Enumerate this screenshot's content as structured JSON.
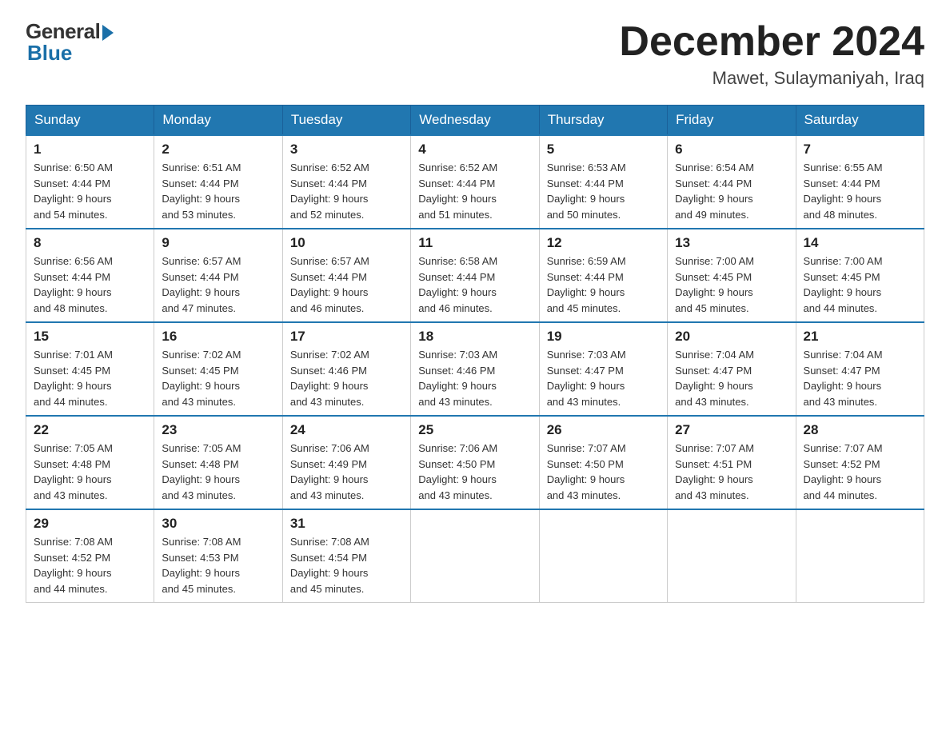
{
  "header": {
    "logo_general": "General",
    "logo_blue": "Blue",
    "month_title": "December 2024",
    "location": "Mawet, Sulaymaniyah, Iraq"
  },
  "days_of_week": [
    "Sunday",
    "Monday",
    "Tuesday",
    "Wednesday",
    "Thursday",
    "Friday",
    "Saturday"
  ],
  "weeks": [
    [
      {
        "day": "1",
        "sunrise": "6:50 AM",
        "sunset": "4:44 PM",
        "daylight": "9 hours and 54 minutes."
      },
      {
        "day": "2",
        "sunrise": "6:51 AM",
        "sunset": "4:44 PM",
        "daylight": "9 hours and 53 minutes."
      },
      {
        "day": "3",
        "sunrise": "6:52 AM",
        "sunset": "4:44 PM",
        "daylight": "9 hours and 52 minutes."
      },
      {
        "day": "4",
        "sunrise": "6:52 AM",
        "sunset": "4:44 PM",
        "daylight": "9 hours and 51 minutes."
      },
      {
        "day": "5",
        "sunrise": "6:53 AM",
        "sunset": "4:44 PM",
        "daylight": "9 hours and 50 minutes."
      },
      {
        "day": "6",
        "sunrise": "6:54 AM",
        "sunset": "4:44 PM",
        "daylight": "9 hours and 49 minutes."
      },
      {
        "day": "7",
        "sunrise": "6:55 AM",
        "sunset": "4:44 PM",
        "daylight": "9 hours and 48 minutes."
      }
    ],
    [
      {
        "day": "8",
        "sunrise": "6:56 AM",
        "sunset": "4:44 PM",
        "daylight": "9 hours and 48 minutes."
      },
      {
        "day": "9",
        "sunrise": "6:57 AM",
        "sunset": "4:44 PM",
        "daylight": "9 hours and 47 minutes."
      },
      {
        "day": "10",
        "sunrise": "6:57 AM",
        "sunset": "4:44 PM",
        "daylight": "9 hours and 46 minutes."
      },
      {
        "day": "11",
        "sunrise": "6:58 AM",
        "sunset": "4:44 PM",
        "daylight": "9 hours and 46 minutes."
      },
      {
        "day": "12",
        "sunrise": "6:59 AM",
        "sunset": "4:44 PM",
        "daylight": "9 hours and 45 minutes."
      },
      {
        "day": "13",
        "sunrise": "7:00 AM",
        "sunset": "4:45 PM",
        "daylight": "9 hours and 45 minutes."
      },
      {
        "day": "14",
        "sunrise": "7:00 AM",
        "sunset": "4:45 PM",
        "daylight": "9 hours and 44 minutes."
      }
    ],
    [
      {
        "day": "15",
        "sunrise": "7:01 AM",
        "sunset": "4:45 PM",
        "daylight": "9 hours and 44 minutes."
      },
      {
        "day": "16",
        "sunrise": "7:02 AM",
        "sunset": "4:45 PM",
        "daylight": "9 hours and 43 minutes."
      },
      {
        "day": "17",
        "sunrise": "7:02 AM",
        "sunset": "4:46 PM",
        "daylight": "9 hours and 43 minutes."
      },
      {
        "day": "18",
        "sunrise": "7:03 AM",
        "sunset": "4:46 PM",
        "daylight": "9 hours and 43 minutes."
      },
      {
        "day": "19",
        "sunrise": "7:03 AM",
        "sunset": "4:47 PM",
        "daylight": "9 hours and 43 minutes."
      },
      {
        "day": "20",
        "sunrise": "7:04 AM",
        "sunset": "4:47 PM",
        "daylight": "9 hours and 43 minutes."
      },
      {
        "day": "21",
        "sunrise": "7:04 AM",
        "sunset": "4:47 PM",
        "daylight": "9 hours and 43 minutes."
      }
    ],
    [
      {
        "day": "22",
        "sunrise": "7:05 AM",
        "sunset": "4:48 PM",
        "daylight": "9 hours and 43 minutes."
      },
      {
        "day": "23",
        "sunrise": "7:05 AM",
        "sunset": "4:48 PM",
        "daylight": "9 hours and 43 minutes."
      },
      {
        "day": "24",
        "sunrise": "7:06 AM",
        "sunset": "4:49 PM",
        "daylight": "9 hours and 43 minutes."
      },
      {
        "day": "25",
        "sunrise": "7:06 AM",
        "sunset": "4:50 PM",
        "daylight": "9 hours and 43 minutes."
      },
      {
        "day": "26",
        "sunrise": "7:07 AM",
        "sunset": "4:50 PM",
        "daylight": "9 hours and 43 minutes."
      },
      {
        "day": "27",
        "sunrise": "7:07 AM",
        "sunset": "4:51 PM",
        "daylight": "9 hours and 43 minutes."
      },
      {
        "day": "28",
        "sunrise": "7:07 AM",
        "sunset": "4:52 PM",
        "daylight": "9 hours and 44 minutes."
      }
    ],
    [
      {
        "day": "29",
        "sunrise": "7:08 AM",
        "sunset": "4:52 PM",
        "daylight": "9 hours and 44 minutes."
      },
      {
        "day": "30",
        "sunrise": "7:08 AM",
        "sunset": "4:53 PM",
        "daylight": "9 hours and 45 minutes."
      },
      {
        "day": "31",
        "sunrise": "7:08 AM",
        "sunset": "4:54 PM",
        "daylight": "9 hours and 45 minutes."
      },
      null,
      null,
      null,
      null
    ]
  ],
  "labels": {
    "sunrise_prefix": "Sunrise: ",
    "sunset_prefix": "Sunset: ",
    "daylight_prefix": "Daylight: "
  }
}
